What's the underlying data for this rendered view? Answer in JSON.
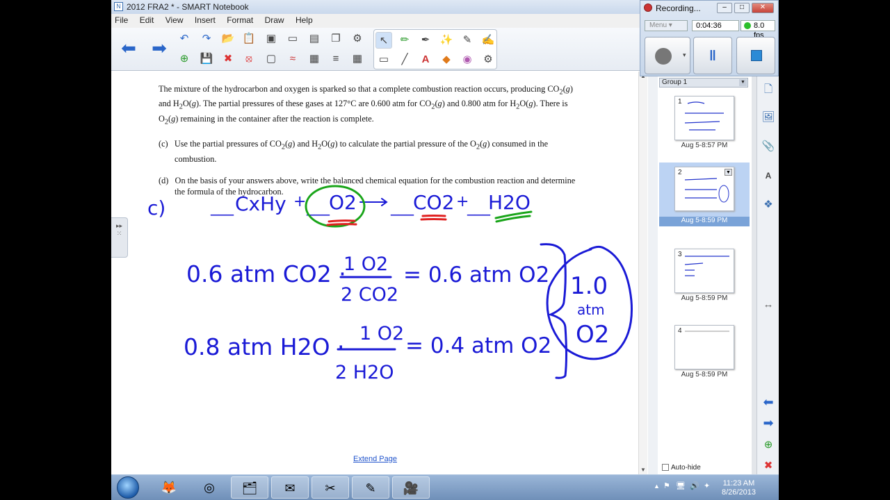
{
  "window": {
    "title": "2012 FRA2 * - SMART Notebook"
  },
  "menu": [
    "File",
    "Edit",
    "View",
    "Insert",
    "Format",
    "Draw",
    "Help"
  ],
  "recording": {
    "title": "Recording...",
    "menu_label": "Menu",
    "elapsed": "0:04:36",
    "fps": "8.0 fps",
    "minimize": "–",
    "maximize": "□",
    "close": "✕"
  },
  "problem": {
    "intro_html": "The mixture of the hydrocarbon and oxygen is sparked so that a complete combustion reaction occurs, producing CO<sub>2</sub>(<i>g</i>) and H<sub>2</sub>O(<i>g</i>). The partial pressures of these gases at 127°C are 0.600 atm for CO<sub>2</sub>(<i>g</i>) and 0.800 atm for H<sub>2</sub>O(<i>g</i>). There is O<sub>2</sub>(<i>g</i>) remaining in the container after the reaction is complete.",
    "part_c_html": "(c)&nbsp;&nbsp; Use the partial pressures of CO<sub>2</sub>(<i>g</i>) and H<sub>2</sub>O(<i>g</i>) to calculate the partial pressure of the O<sub>2</sub>(<i>g</i>) consumed in the combustion.",
    "part_d_html": "(d)&nbsp;&nbsp; On the basis of your answers above, write the balanced chemical equation for the combustion reaction and determine the formula of the hydrocarbon."
  },
  "handwriting": {
    "label": "c)",
    "blank": "___",
    "reactant1": "CxHy",
    "plus": "+",
    "oxygen": "O2",
    "product1": "CO2",
    "product2": "H2O",
    "line1_start": "0.6 atm CO2 ·",
    "line1_num": "1 O2",
    "line1_den": "2 CO2",
    "line1_result": "= 0.6 atm O2",
    "line2_start": "0.8 atm H2O ·",
    "line2_num": "1 O2",
    "line2_den": "2 H2O",
    "line2_result": "= 0.4 atm O2",
    "total_value": "1.0",
    "total_unit": "atm",
    "total_species": "O2"
  },
  "extend_page": "Extend Page",
  "sorter": {
    "group": "Group 1",
    "pages": [
      {
        "num": "1",
        "date": "Aug 5-8:57 PM"
      },
      {
        "num": "2",
        "date": "Aug 5-8:59 PM"
      },
      {
        "num": "3",
        "date": "Aug 5-8:59 PM"
      },
      {
        "num": "4",
        "date": "Aug 5-8:59 PM"
      }
    ],
    "selected_page": 2,
    "autohide": "Auto-hide"
  },
  "taskbar": {
    "time": "11:23 AM",
    "date": "8/26/2013"
  },
  "colors": {
    "ink_blue": "#1a1ad6",
    "ink_green": "#1aa51a",
    "ink_red": "#e02020",
    "selection": "#bcd3f3"
  }
}
